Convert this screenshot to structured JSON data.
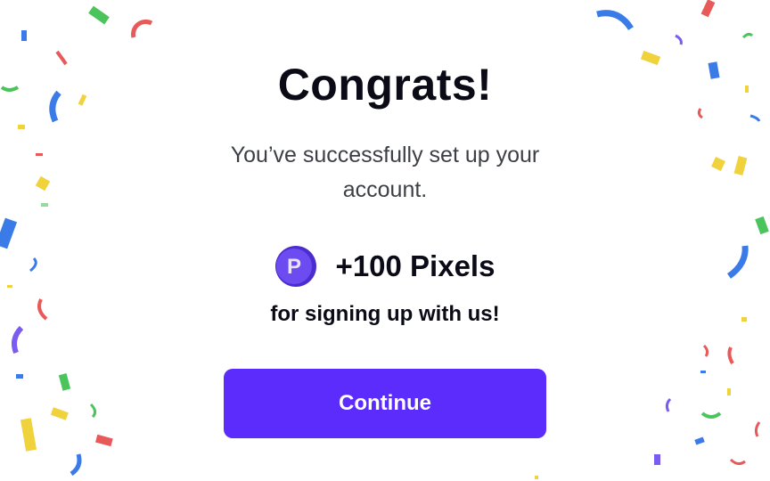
{
  "title": "Congrats!",
  "subtitle": "You’ve successfully set up your account.",
  "reward": {
    "coin_letter": "P",
    "amount_text": "+100 Pixels",
    "note": "for signing up with us!"
  },
  "continue_button": {
    "label": "Continue"
  },
  "colors": {
    "accent": "#5b2cfc",
    "coin": "#6c4cf0",
    "text": "#0b0b17",
    "subtext": "#3c3f45",
    "confetti": [
      "#3b7be8",
      "#f0d23c",
      "#e85a5a",
      "#4cc45c",
      "#7a5cf0"
    ]
  },
  "icons": {
    "coin": "pixel-coin-icon",
    "confetti": "confetti-decoration"
  }
}
